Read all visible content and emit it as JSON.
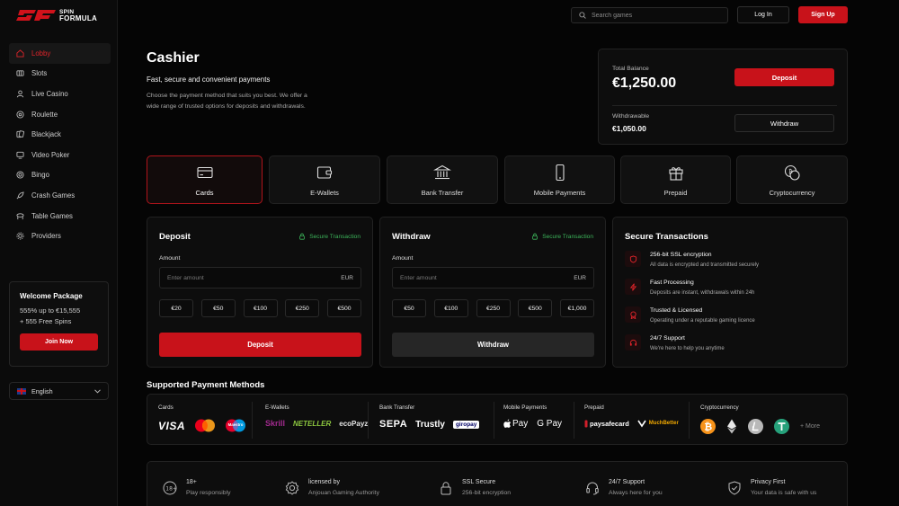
{
  "brand": {
    "line1": "SPIN",
    "line2": "FORMULA"
  },
  "colors": {
    "accent": "#c8121a",
    "secure_green": "#3cb45a"
  },
  "sidebar": {
    "items": [
      {
        "label": "Lobby",
        "icon": "lobby-icon",
        "active": true
      },
      {
        "label": "Slots",
        "icon": "slots-icon"
      },
      {
        "label": "Live Casino",
        "icon": "live-casino-icon"
      },
      {
        "label": "Roulette",
        "icon": "roulette-icon"
      },
      {
        "label": "Blackjack",
        "icon": "cards-icon"
      },
      {
        "label": "Video Poker",
        "icon": "video-poker-icon"
      },
      {
        "label": "Bingo",
        "icon": "bingo-icon"
      },
      {
        "label": "Crash Games",
        "icon": "rocket-icon"
      },
      {
        "label": "Table Games",
        "icon": "table-icon"
      },
      {
        "label": "Providers",
        "icon": "providers-icon"
      }
    ],
    "welcome": {
      "title": "Welcome Package",
      "line1": "555% up to €15,555",
      "line2": "+ 555 Free Spins",
      "cta": "Join Now"
    },
    "language": "English"
  },
  "header": {
    "search_placeholder": "Search games",
    "login": "Log In",
    "signup": "Sign Up"
  },
  "cashier": {
    "title": "Cashier",
    "subtitle": "Fast, secure and convenient payments",
    "description": "Choose the payment method that suits you best. We offer a wide range of trusted options for deposits and withdrawals."
  },
  "balance": {
    "total_label": "Total Balance",
    "total": "€1,250.00",
    "withdrawable_label": "Withdrawable",
    "withdrawable": "€1,050.00",
    "deposit_btn": "Deposit",
    "withdraw_btn": "Withdraw"
  },
  "methods": [
    {
      "label": "Cards",
      "icon": "card-icon",
      "active": true
    },
    {
      "label": "E-Wallets",
      "icon": "wallet-icon"
    },
    {
      "label": "Bank Transfer",
      "icon": "bank-icon"
    },
    {
      "label": "Mobile Payments",
      "icon": "phone-icon"
    },
    {
      "label": "Prepaid",
      "icon": "gift-icon"
    },
    {
      "label": "Cryptocurrency",
      "icon": "crypto-icon"
    }
  ],
  "deposit": {
    "title": "Deposit",
    "secure": "Secure Transaction",
    "amount_label": "Amount",
    "placeholder": "Enter amount",
    "currency": "EUR",
    "chips": [
      "€20",
      "€50",
      "€100",
      "€250",
      "€500"
    ],
    "action": "Deposit"
  },
  "withdraw": {
    "title": "Withdraw",
    "secure": "Secure Transaction",
    "amount_label": "Amount",
    "placeholder": "Enter amount",
    "currency": "EUR",
    "chips": [
      "€50",
      "€100",
      "€250",
      "€500",
      "€1,000"
    ],
    "action": "Withdraw"
  },
  "secure_transactions": {
    "title": "Secure Transactions",
    "items": [
      {
        "title": "256-bit SSL encryption",
        "desc": "All data is encrypted and transmitted securely",
        "icon": "shield-icon"
      },
      {
        "title": "Fast Processing",
        "desc": "Deposits are instant, withdrawals within 24h",
        "icon": "lightning-icon"
      },
      {
        "title": "Trusted & Licensed",
        "desc": "Operating under a reputable gaming licence",
        "icon": "badge-icon"
      },
      {
        "title": "24/7 Support",
        "desc": "We're here to help you anytime",
        "icon": "headset-icon"
      }
    ]
  },
  "supported": {
    "title": "Supported Payment Methods",
    "groups": {
      "cards": {
        "label": "Cards",
        "logos": [
          "VISA",
          "Maestro"
        ]
      },
      "ewallets": {
        "label": "E-Wallets",
        "logos": [
          "Skrill",
          "NETELLER",
          "ecoPayz"
        ]
      },
      "bank": {
        "label": "Bank Transfer",
        "logos": [
          "SEPA",
          "Trustly",
          "giropay"
        ]
      },
      "mobile": {
        "label": "Mobile Payments",
        "logos": [
          "Pay",
          "G Pay"
        ]
      },
      "prepaid": {
        "label": "Prepaid",
        "logos": [
          "paysafecard",
          "MuchBetter"
        ]
      },
      "crypto": {
        "label": "Cryptocurrency",
        "more": "+ More"
      }
    }
  },
  "footer": [
    {
      "title": "18+",
      "desc": "Play responsibly",
      "icon": "age-18-icon"
    },
    {
      "title": "licensed by",
      "desc": "Anjouan Gaming Authority",
      "icon": "seal-icon"
    },
    {
      "title": "SSL Secure",
      "desc": "256-bit encryption",
      "icon": "lock-icon"
    },
    {
      "title": "24/7 Support",
      "desc": "Always here for you",
      "icon": "headset-icon"
    },
    {
      "title": "Privacy First",
      "desc": "Your data is safe with us",
      "icon": "shield-check-icon"
    }
  ]
}
